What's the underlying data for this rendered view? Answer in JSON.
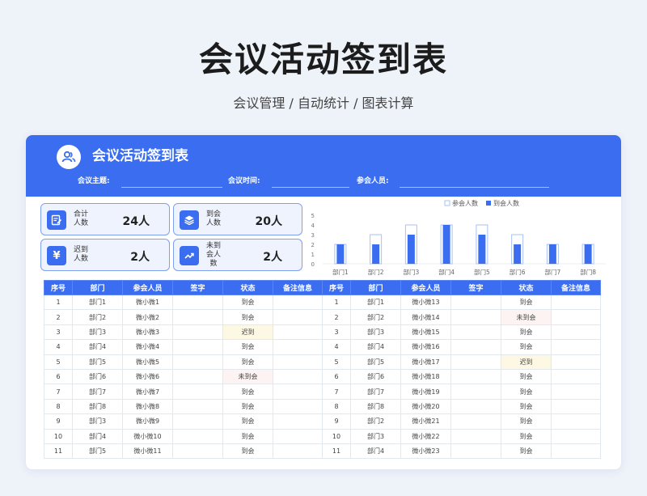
{
  "page": {
    "title": "会议活动签到表",
    "subtitle": "会议管理 / 自动统计 / 图表计算"
  },
  "header": {
    "title": "会议活动签到表",
    "icon": "users-icon",
    "fields": [
      {
        "label": "会议主题:"
      },
      {
        "label": "会议时间:"
      },
      {
        "label": "参会人员:"
      }
    ]
  },
  "stats": [
    {
      "label": "合计\n人数",
      "value": "24人",
      "icon": "edit-icon"
    },
    {
      "label": "到会\n人数",
      "value": "20人",
      "icon": "layers-icon"
    },
    {
      "label": "迟到\n人数",
      "value": "2人",
      "icon": "yen-icon"
    },
    {
      "label": "未到\n会人\n数",
      "value": "2人",
      "icon": "trend-icon"
    }
  ],
  "chart_data": {
    "type": "bar",
    "categories": [
      "部门1",
      "部门2",
      "部门3",
      "部门4",
      "部门5",
      "部门6",
      "部门7",
      "部门8"
    ],
    "series": [
      {
        "name": "参会人数",
        "values": [
          2,
          3,
          4,
          4,
          4,
          3,
          2,
          2
        ],
        "color": "#ffffff",
        "border": "#a9c2f5"
      },
      {
        "name": "到会人数",
        "values": [
          2,
          2,
          3,
          4,
          3,
          2,
          2,
          2
        ],
        "color": "#3a6df0"
      }
    ],
    "yticks": [
      0,
      1,
      2,
      3,
      4,
      5
    ],
    "ylim": [
      0,
      5
    ],
    "legend": "top",
    "grid": false
  },
  "table": {
    "headers": [
      "序号",
      "部门",
      "参会人员",
      "签字",
      "状态",
      "备注信息"
    ],
    "left": [
      [
        "1",
        "部门1",
        "微小微1",
        "",
        "到会",
        ""
      ],
      [
        "2",
        "部门2",
        "微小微2",
        "",
        "到会",
        ""
      ],
      [
        "3",
        "部门3",
        "微小微3",
        "",
        "迟到",
        ""
      ],
      [
        "4",
        "部门4",
        "微小微4",
        "",
        "到会",
        ""
      ],
      [
        "5",
        "部门5",
        "微小微5",
        "",
        "到会",
        ""
      ],
      [
        "6",
        "部门6",
        "微小微6",
        "",
        "未到会",
        ""
      ],
      [
        "7",
        "部门7",
        "微小微7",
        "",
        "到会",
        ""
      ],
      [
        "8",
        "部门8",
        "微小微8",
        "",
        "到会",
        ""
      ],
      [
        "9",
        "部门3",
        "微小微9",
        "",
        "到会",
        ""
      ],
      [
        "10",
        "部门4",
        "微小微10",
        "",
        "到会",
        ""
      ],
      [
        "11",
        "部门5",
        "微小微11",
        "",
        "到会",
        ""
      ]
    ],
    "right": [
      [
        "1",
        "部门1",
        "微小微13",
        "",
        "到会",
        ""
      ],
      [
        "2",
        "部门2",
        "微小微14",
        "",
        "未到会",
        ""
      ],
      [
        "3",
        "部门3",
        "微小微15",
        "",
        "到会",
        ""
      ],
      [
        "4",
        "部门4",
        "微小微16",
        "",
        "到会",
        ""
      ],
      [
        "5",
        "部门5",
        "微小微17",
        "",
        "迟到",
        ""
      ],
      [
        "6",
        "部门6",
        "微小微18",
        "",
        "到会",
        ""
      ],
      [
        "7",
        "部门7",
        "微小微19",
        "",
        "到会",
        ""
      ],
      [
        "8",
        "部门8",
        "微小微20",
        "",
        "到会",
        ""
      ],
      [
        "9",
        "部门2",
        "微小微21",
        "",
        "到会",
        ""
      ],
      [
        "10",
        "部门3",
        "微小微22",
        "",
        "到会",
        ""
      ],
      [
        "11",
        "部门4",
        "微小微23",
        "",
        "到会",
        ""
      ]
    ],
    "status_styles": {
      "迟到": "late",
      "未到会": "absent"
    }
  }
}
